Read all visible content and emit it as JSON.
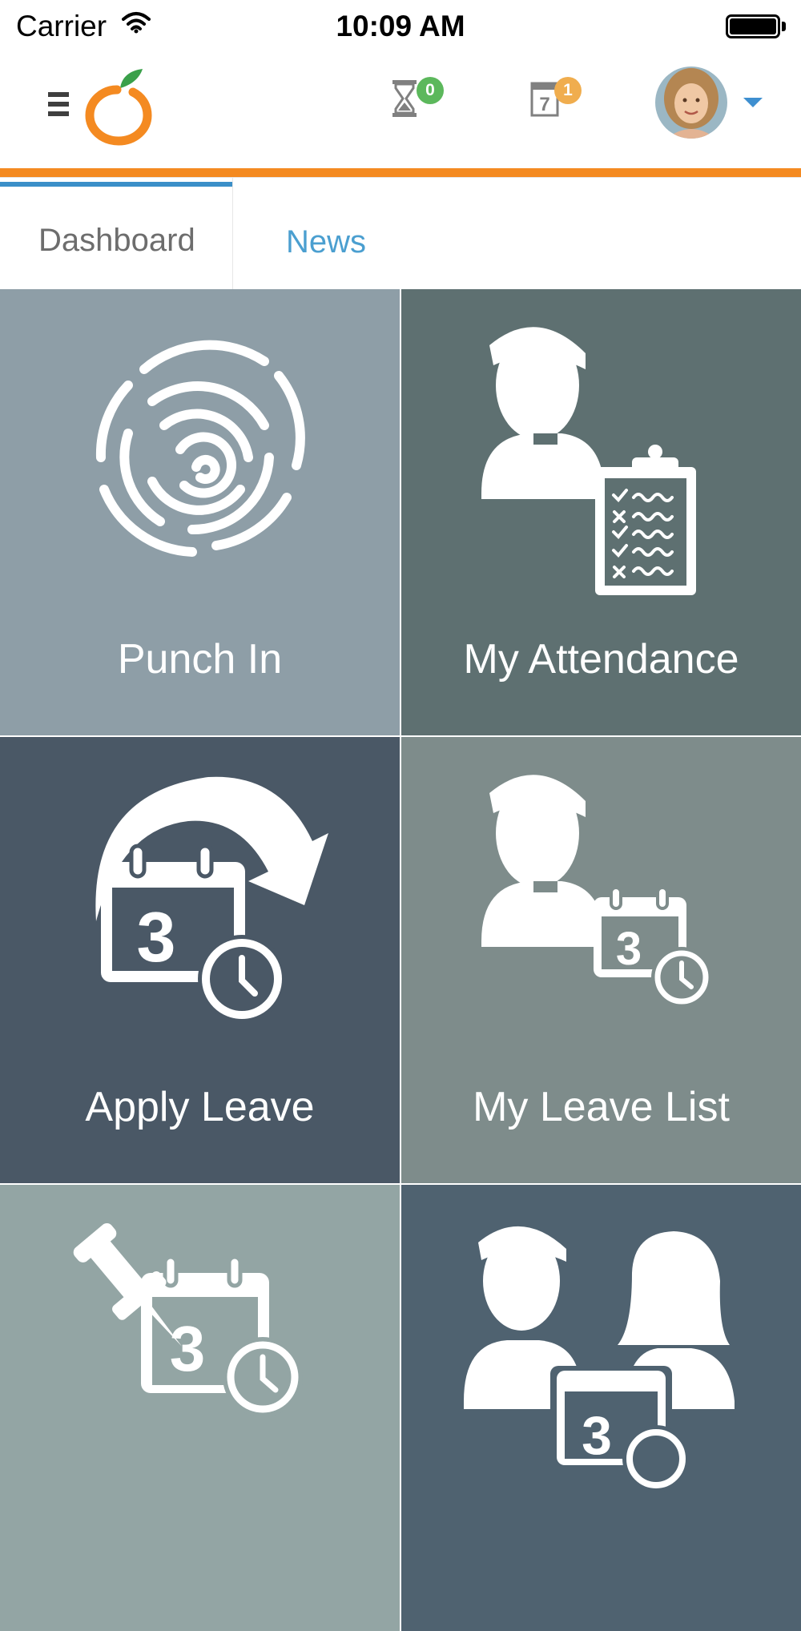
{
  "status_bar": {
    "carrier": "Carrier",
    "time": "10:09 AM",
    "icons": [
      "wifi-icon",
      "battery-icon"
    ]
  },
  "header": {
    "menu_icon": "hamburger-icon",
    "logo_icon": "orange-logo-icon",
    "pending_timesheets": {
      "icon": "hourglass-icon",
      "count": "0",
      "badge_color": "#5cb85c"
    },
    "pending_leaves": {
      "icon": "calendar-icon",
      "count": "1",
      "badge_color": "#f0ad4e"
    },
    "user_menu": {
      "icon": "chevron-down-icon"
    }
  },
  "colors": {
    "accent_orange": "#f48a21",
    "active_tab_blue": "#3b8fc8",
    "tile_punch_in": "#8e9ea7",
    "tile_my_attendance": "#5e7071",
    "tile_apply_leave": "#4a5866",
    "tile_my_leave_list": "#7e8c8b",
    "tile_assign_leave": "#93a5a4",
    "tile_leave_list": "#4f6270"
  },
  "tabs": [
    {
      "label": "Dashboard",
      "active": true
    },
    {
      "label": "News",
      "active": false
    }
  ],
  "tiles": [
    {
      "label": "Punch In",
      "icon": "fingerprint-icon"
    },
    {
      "label": "My Attendance",
      "icon": "attendance-clipboard-icon"
    },
    {
      "label": "Apply Leave",
      "icon": "apply-leave-calendar-icon"
    },
    {
      "label": "My Leave List",
      "icon": "my-leave-list-icon"
    },
    {
      "label": "",
      "icon": "pinned-calendar-icon"
    },
    {
      "label": "",
      "icon": "team-leave-icon"
    }
  ]
}
